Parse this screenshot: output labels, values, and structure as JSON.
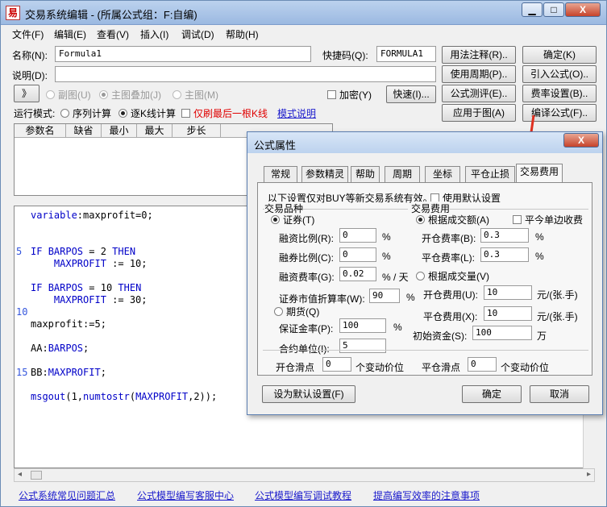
{
  "window": {
    "title": "交易系统编辑 - (所属公式组：F:自编)",
    "controls": {
      "min": "▁",
      "max": "□",
      "close": "X"
    }
  },
  "menu": [
    "文件(F)",
    "编辑(E)",
    "查看(V)",
    "插入(I)",
    "调试(D)",
    "帮助(H)"
  ],
  "form": {
    "name_label": "名称(N):",
    "name_value": "Formula1",
    "shortcut_label": "快捷码(Q):",
    "shortcut_value": "FORMULA1",
    "desc_label": "说明(D):",
    "desc_value": "",
    "expand_btn": "》",
    "radio_subchart": "副图(U)",
    "radio_overlay": "主图叠加(J)",
    "radio_main": "主图(M)",
    "encrypt": "加密(Y)",
    "quick_btn": "快速(I)...",
    "run_mode_label": "运行模式:",
    "run_seq": "序列计算",
    "run_k": "逐K线计算",
    "refresh_last": "仅刷最后一根K线",
    "mode_help": "模式说明"
  },
  "right_buttons": {
    "usage": "用法注释(R)..",
    "ok": "确定(K)",
    "period": "使用周期(P)..",
    "import": "引入公式(O)..",
    "test": "公式测评(E)..",
    "fee": "费率设置(B)..",
    "apply": "应用于图(A)",
    "compile": "编译公式(F).."
  },
  "param_grid": {
    "headers": [
      "参数名",
      "缺省",
      "最小",
      "最大",
      "步长"
    ]
  },
  "code": {
    "lines": [
      {
        "n": "",
        "t": "variable:maxprofit=0;"
      },
      {
        "n": "",
        "t": ""
      },
      {
        "n": "",
        "t": ""
      },
      {
        "n": "5",
        "t": "IF BARPOS = 2 THEN"
      },
      {
        "n": "",
        "t": "    MAXPROFIT := 10;"
      },
      {
        "n": "",
        "t": ""
      },
      {
        "n": "",
        "t": "IF BARPOS = 10 THEN"
      },
      {
        "n": "",
        "t": "    MAXPROFIT := 30;"
      },
      {
        "n": "10",
        "t": ""
      },
      {
        "n": "",
        "t": "maxprofit:=5;"
      },
      {
        "n": "",
        "t": ""
      },
      {
        "n": "",
        "t": "AA:BARPOS;"
      },
      {
        "n": "",
        "t": ""
      },
      {
        "n": "15",
        "t": "BB:MAXPROFIT;"
      },
      {
        "n": "",
        "t": ""
      },
      {
        "n": "",
        "t": "msgout(1,numtostr(MAXPROFIT,2));"
      }
    ]
  },
  "footer_links": [
    "公式系统常见问题汇总",
    "公式模型编写客服中心",
    "公式模型编写调试教程",
    "提高编写效率的注意事项"
  ],
  "dialog": {
    "title": "公式属性",
    "close": "X",
    "tabs": [
      "常规",
      "参数精灵",
      "帮助",
      "周期",
      "坐标",
      "平仓止损",
      "交易费用"
    ],
    "active_tab": "交易费用",
    "note": "以下设置仅对BUY等新交易系统有效。",
    "use_default": "使用默认设置",
    "variety_group": "交易品种",
    "stock": "证券(T)",
    "margin_ratio_label": "融资比例(R):",
    "margin_ratio": "0",
    "short_ratio_label": "融券比例(C):",
    "short_ratio": "0",
    "margin_fee_label": "融资费率(G):",
    "margin_fee": "0.02",
    "pct_day": "% / 天",
    "pct": "%",
    "discount_label": "证券市值折算率(W):",
    "discount": "90",
    "futures": "期货(Q)",
    "deposit_label": "保证金率(P):",
    "deposit": "100",
    "contract_label": "合约单位(I):",
    "contract": "5",
    "fee_group": "交易费用",
    "by_amount": "根据成交额(A)",
    "close_one_side": "平今单边收费",
    "open_rate_label": "开仓费率(B):",
    "open_rate": "0.3",
    "close_rate_label": "平仓费率(L):",
    "close_rate": "0.3",
    "by_volume": "根据成交量(V)",
    "open_fee_label": "开仓费用(U):",
    "open_fee": "10",
    "close_fee_label": "平仓费用(X):",
    "close_fee": "10",
    "per_hand": "元/(张.手)",
    "init_fund_label": "初始资金(S):",
    "init_fund": "100",
    "wan": "万",
    "open_slip_label": "开仓滑点",
    "open_slip": "0",
    "close_slip_label": "平仓滑点",
    "close_slip": "0",
    "tick_unit": "个变动价位",
    "set_default_btn": "设为默认设置(F)",
    "ok_btn": "确定",
    "cancel_btn": "取消"
  },
  "colors": {
    "arrow": "#e03020",
    "link": "#1a1acc",
    "red_text": "#e00000"
  }
}
